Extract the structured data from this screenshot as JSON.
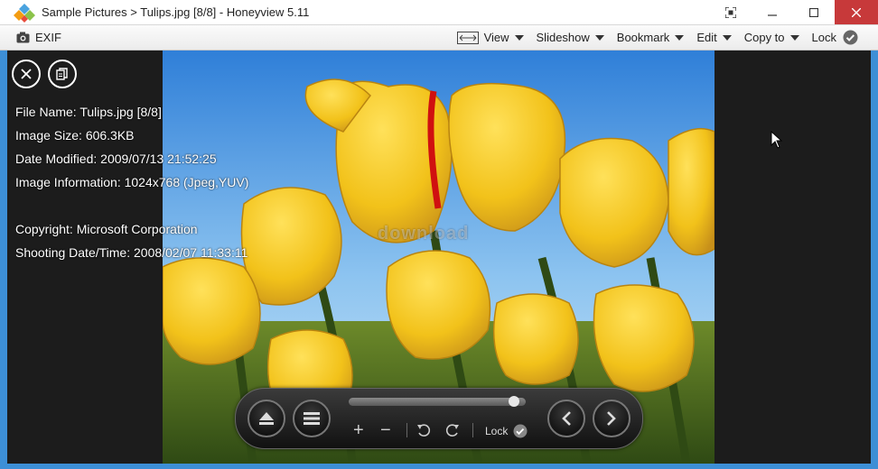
{
  "window": {
    "title": "Sample Pictures > Tulips.jpg [8/8] - Honeyview 5.11",
    "app_icon": "honeyview-diamond-icon"
  },
  "toolbar": {
    "exif_label": "EXIF",
    "menus": {
      "view": "View",
      "slideshow": "Slideshow",
      "bookmark": "Bookmark",
      "edit": "Edit",
      "copy_to": "Copy to",
      "lock": "Lock"
    }
  },
  "info": {
    "file_name": "File Name: Tulips.jpg [8/8]",
    "image_size": "Image Size: 606.3KB",
    "date_modified": "Date Modified: 2009/07/13 21:52:25",
    "image_information": "Image Information: 1024x768 (Jpeg,YUV)",
    "copyright": "Copyright: Microsoft Corporation",
    "shooting_date": "Shooting Date/Time: 2008/02/07 11:33:11"
  },
  "watermark": "download",
  "controls": {
    "lock_label": "Lock",
    "slider_position": 0.96
  },
  "colors": {
    "title_close": "#c7393a",
    "viewer_bg": "#1c1c1c",
    "sky": "#7ab9ee",
    "tulip": "#f2c21a"
  }
}
